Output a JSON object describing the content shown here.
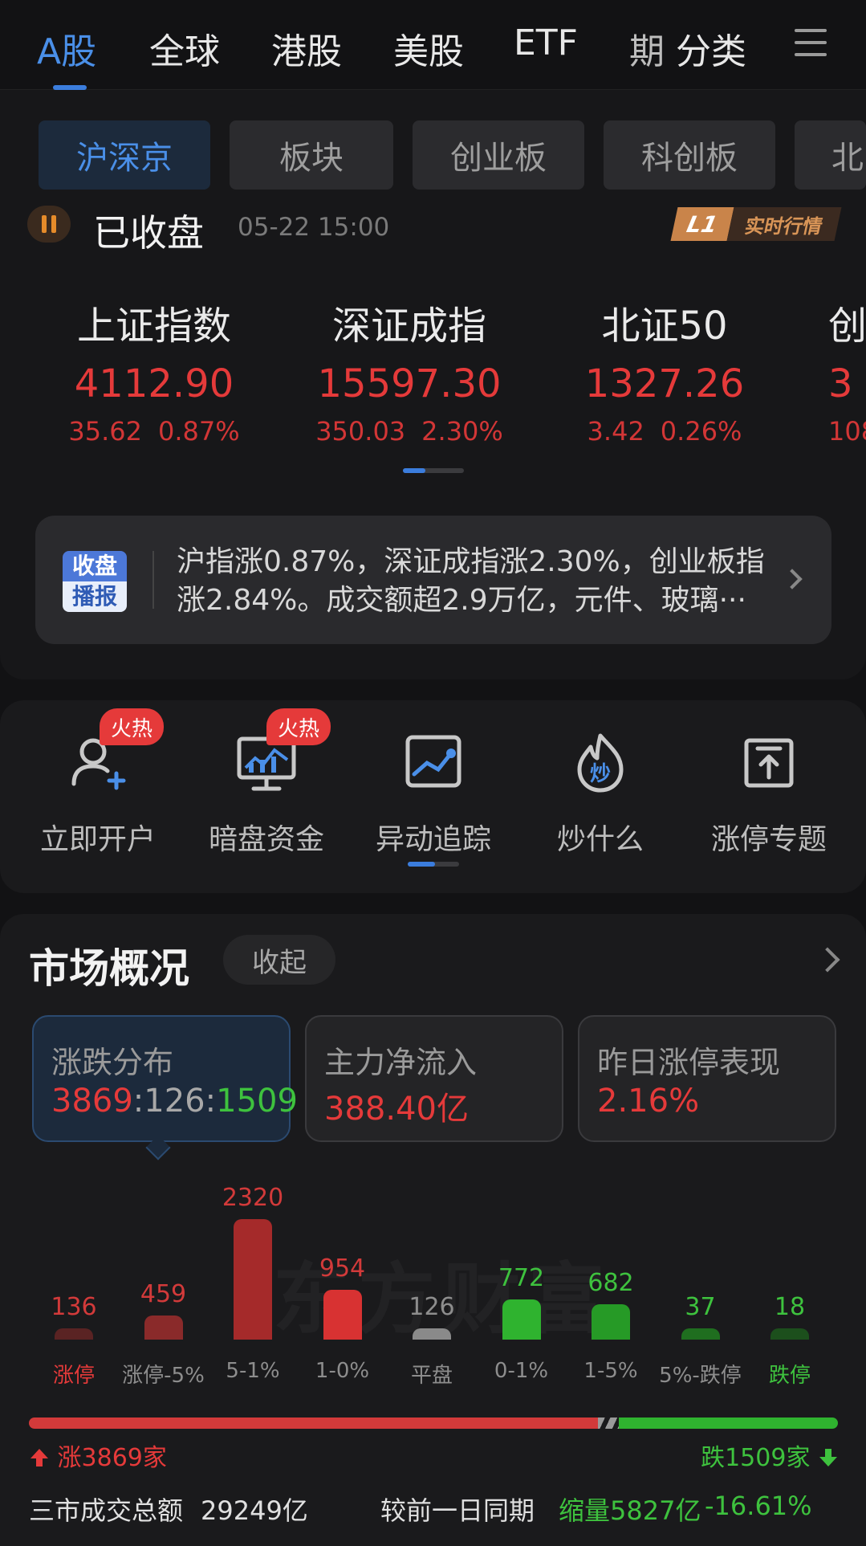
{
  "top_tabs": [
    {
      "label": "A股",
      "active": true
    },
    {
      "label": "全球"
    },
    {
      "label": "港股"
    },
    {
      "label": "美股"
    },
    {
      "label": "ETF"
    },
    {
      "label": "期"
    },
    {
      "label": "分类"
    }
  ],
  "sub_tabs": [
    {
      "label": "沪深京",
      "active": true
    },
    {
      "label": "板块"
    },
    {
      "label": "创业板"
    },
    {
      "label": "科创板"
    },
    {
      "label": "北"
    }
  ],
  "status": {
    "text": "已收盘",
    "time": "05-22  15:00",
    "badge_l1": "L1",
    "badge_text": "实时行情"
  },
  "indices": [
    {
      "name": "上证指数",
      "value": "4112.90",
      "change": "35.62",
      "pct": "0.87%"
    },
    {
      "name": "深证成指",
      "value": "15597.30",
      "change": "350.03",
      "pct": "2.30%"
    },
    {
      "name": "北证50",
      "value": "1327.26",
      "change": "3.42",
      "pct": "0.26%"
    },
    {
      "name": "创",
      "value": "3",
      "change": "108",
      "pct": ""
    }
  ],
  "broadcast": {
    "badge_top": "收盘",
    "badge_bottom": "播报",
    "line1": "沪指涨0.87%，深证成指涨2.30%，创业板指",
    "line2": "涨2.84%。成交额超2.9万亿，元件、玻璃···"
  },
  "shortcuts": [
    {
      "label": "立即开户",
      "icon": "user-add-icon",
      "hot": "火热"
    },
    {
      "label": "暗盘资金",
      "icon": "monitor-chart-icon",
      "hot": "火热"
    },
    {
      "label": "异动追踪",
      "icon": "tracking-icon"
    },
    {
      "label": "炒什么",
      "icon": "flame-icon",
      "icon_text": "炒"
    },
    {
      "label": "涨停专题",
      "icon": "limit-up-icon"
    }
  ],
  "market_overview": {
    "title": "市场概况",
    "collapse_label": "收起",
    "cards": [
      {
        "title": "涨跌分布",
        "up": "3869",
        "sep1": ":",
        "flat": "126",
        "sep2": ":",
        "down": "1509",
        "active": true
      },
      {
        "title": "主力净流入",
        "value": "388.40亿"
      },
      {
        "title": "昨日涨停表现",
        "value": "2.16%"
      }
    ]
  },
  "chart_data": {
    "type": "bar",
    "categories": [
      "涨停",
      "涨停-5%",
      "5-1%",
      "1-0%",
      "平盘",
      "0-1%",
      "1-5%",
      "5%-跌停",
      "跌停"
    ],
    "values": [
      136,
      459,
      2320,
      954,
      126,
      772,
      682,
      37,
      18
    ],
    "colors": [
      "#5a2323",
      "#8a2a2a",
      "#a52a2a",
      "#d83232",
      "#8a8a8a",
      "#2fb32f",
      "#269a26",
      "#1f6e1f",
      "#1c4f1c"
    ],
    "value_colors": [
      "#d23a3a",
      "#d23a3a",
      "#d23a3a",
      "#d23a3a",
      "#8d8d8d",
      "#3ec23e",
      "#3ec23e",
      "#3ec23e",
      "#3ec23e"
    ],
    "label_colors": [
      "#e53a3a",
      "#8d8d8d",
      "#8d8d8d",
      "#8d8d8d",
      "#8d8d8d",
      "#8d8d8d",
      "#8d8d8d",
      "#8d8d8d",
      "#3ec23e"
    ]
  },
  "watermark": "东方财富",
  "ratio": {
    "up_label": "涨3869家",
    "down_label": "跌1509家",
    "up": 3869,
    "flat": 126,
    "down": 1509
  },
  "turnover": {
    "label": "三市成交总额",
    "value": "29249亿",
    "compare_label": "较前一日同期",
    "shrink": "缩量5827亿",
    "pct": "-16.61%"
  }
}
